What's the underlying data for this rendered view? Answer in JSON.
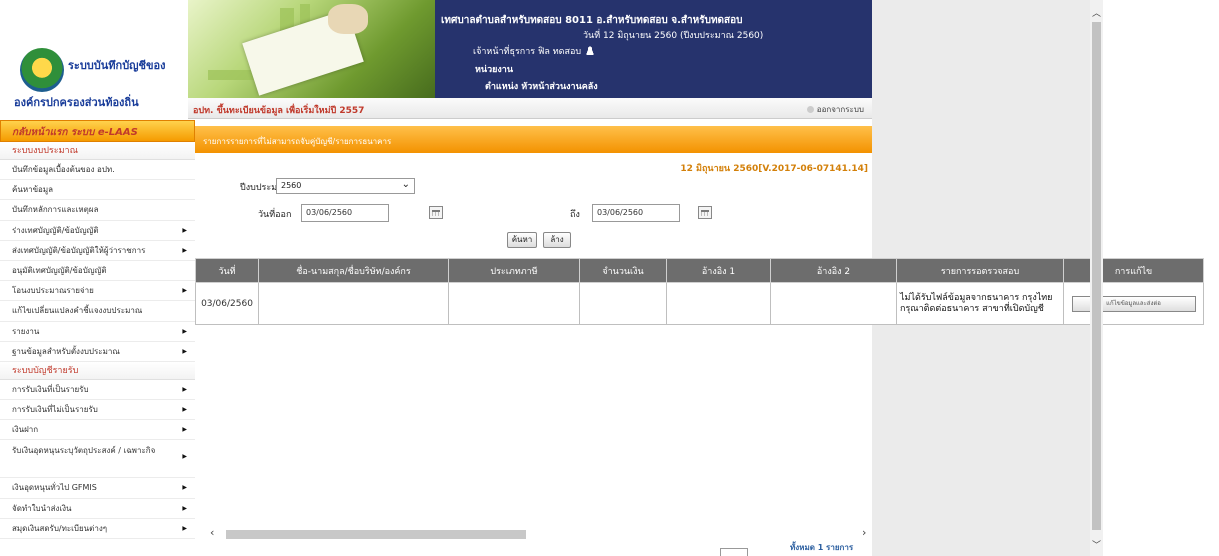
{
  "header": {
    "logo_line1": "ระบบบันทึกบัญชีของ",
    "logo_line2": "องค์กรปกครองส่วนท้องถิ่น",
    "org_name": "เทศบาลตำบลสำหรับทดสอบ 8011 อ.สำหรับทดสอบ จ.สำหรับทดสอบ",
    "date_text": "วันที่ 12 มิถุนายน 2560  (ปีงบประมาณ 2560)",
    "user_text": "เจ้าหน้าที่ธุรการ ฟิล ทดสอบ",
    "unit_text": "หน่วยงาน",
    "position_text": "ตำแหน่ง หัวหน้าส่วนงานคลัง",
    "subsystem_title": "อปท. ขึ้นทะเบียนข้อมูล เพื่อเริ่มใหม่ปี 2557",
    "logout_label": "ออกจากระบบ"
  },
  "sidebar": {
    "header": "กลับหน้าแรก ระบบ e-LAAS",
    "sections": [
      {
        "title": "ระบบงบประมาณ",
        "items": [
          {
            "label": "บันทึกข้อมูลเบื้องต้นของ อปท.",
            "arrow": false
          },
          {
            "label": "ค้นหาข้อมูล",
            "arrow": false
          },
          {
            "label": "บันทึกหลักการและเหตุผล",
            "arrow": false
          },
          {
            "label": "ร่างเทศบัญญัติ/ข้อบัญญัติ",
            "arrow": true
          },
          {
            "label": "ส่งเทศบัญญัติ/ข้อบัญญัติให้ผู้ว่าราชการ",
            "arrow": true
          },
          {
            "label": "อนุมัติเทศบัญญัติ/ข้อบัญญัติ",
            "arrow": false
          },
          {
            "label": "โอนงบประมาณรายจ่าย",
            "arrow": true
          },
          {
            "label": "แก้ไขเปลี่ยนแปลงคำชี้แจงงบประมาณ",
            "arrow": false
          },
          {
            "label": "รายงาน",
            "arrow": true
          },
          {
            "label": "ฐานข้อมูลสำหรับตั้งงบประมาณ",
            "arrow": true
          }
        ]
      },
      {
        "title": "ระบบบัญชีรายรับ",
        "items": [
          {
            "label": "การรับเงินที่เป็นรายรับ",
            "arrow": true
          },
          {
            "label": "การรับเงินที่ไม่เป็นรายรับ",
            "arrow": true
          },
          {
            "label": "เงินฝาก",
            "arrow": true
          },
          {
            "label": "รับเงินอุดหนุนระบุวัตถุประสงค์ / เฉพาะกิจ",
            "arrow": true,
            "tall": true
          },
          {
            "label": "เงินอุดหนุนทั่วไป GFMIS",
            "arrow": true
          },
          {
            "label": "จัดทำใบนำส่งเงิน",
            "arrow": true
          },
          {
            "label": "สมุดเงินสดรับ/ทะเบียนต่างๆ",
            "arrow": true
          }
        ]
      }
    ]
  },
  "main": {
    "banner_text": "รายการรายการที่ไม่สามารถจับคู่บัญชี/รายการธนาคาร",
    "timestamp": "12 มิถุนายน 2560[V.2017-06-07141.14]",
    "fiscal_label": "ปีงบประมาณ",
    "fiscal_required": "*",
    "fiscal_value": "2560",
    "date_from_label": "วันที่ออก",
    "date_from_value": "03/06/2560",
    "date_to_label": "ถึง",
    "date_to_value": "03/06/2560",
    "search_button": "ค้นหา",
    "clear_button": "ล้าง",
    "record_count": "ทั้งหมด 1 รายการ"
  },
  "table": {
    "columns": [
      "วันที่",
      "ชื่อ-นามสกุล/ชื่อบริษัท/องค์กร",
      "ประเภทภาษี",
      "จำนวนเงิน",
      "อ้างอิง 1",
      "อ้างอิง 2",
      "รายการรอตรวจสอบ",
      "การแก้ไข"
    ],
    "rows": [
      {
        "date": "03/06/2560",
        "name": "",
        "tax_type": "",
        "amount": "",
        "ref1": "",
        "ref2": "",
        "note": "ไม่ได้รับไฟล์ข้อมูลจากธนาคาร กรุงไทย กรุณาติดต่อธนาคาร สาขาที่เปิดบัญชี",
        "edit_label": "แก้ไขข้อมูลและส่งต่อ"
      }
    ]
  }
}
